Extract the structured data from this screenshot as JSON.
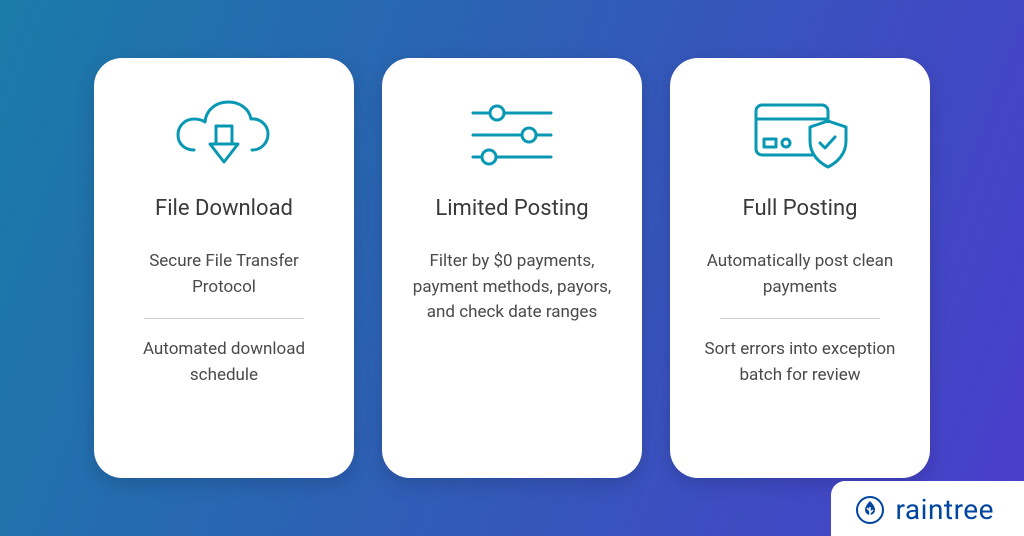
{
  "cards": [
    {
      "icon": "cloud-download-icon",
      "title": "File Download",
      "items": [
        "Secure File Transfer Protocol",
        "Automated download schedule"
      ]
    },
    {
      "icon": "sliders-icon",
      "title": "Limited Posting",
      "items": [
        "Filter by $0 payments, payment methods, payors, and check date ranges"
      ]
    },
    {
      "icon": "card-shield-icon",
      "title": "Full Posting",
      "items": [
        "Automatically post clean payments",
        "Sort errors into exception batch for review"
      ]
    }
  ],
  "logo": {
    "text": "raintree"
  },
  "colors": {
    "iconStroke": "#0898b4",
    "logo": "#0046a0"
  }
}
